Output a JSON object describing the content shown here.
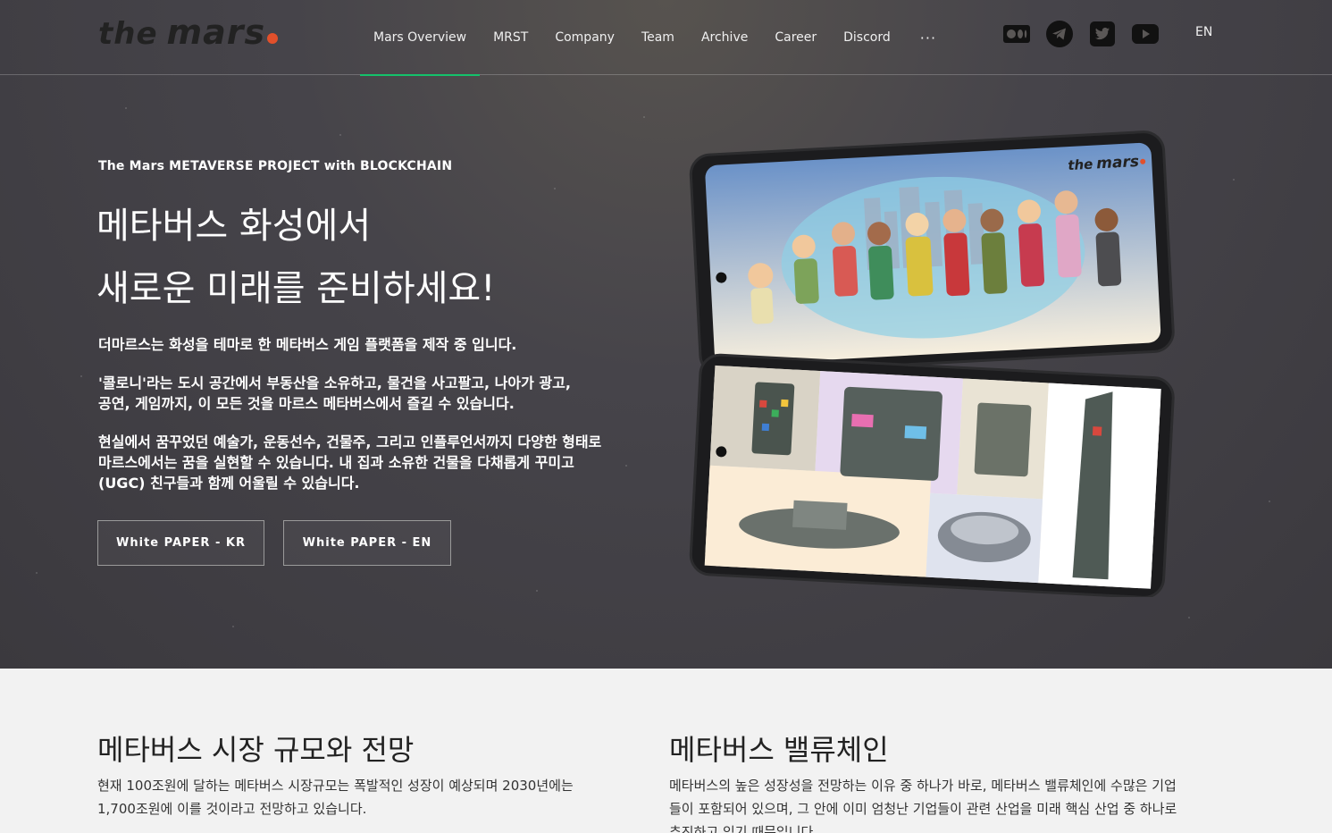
{
  "brand": {
    "name_prefix": "the",
    "name": "mars",
    "accent_color": "#e2502b"
  },
  "nav": {
    "items": [
      {
        "label": "Mars Overview",
        "active": true
      },
      {
        "label": "MRST",
        "active": false
      },
      {
        "label": "Company",
        "active": false
      },
      {
        "label": "Team",
        "active": false
      },
      {
        "label": "Archive",
        "active": false
      },
      {
        "label": "Career",
        "active": false
      },
      {
        "label": "Discord",
        "active": false
      }
    ],
    "more_label": "···",
    "active_color": "#14c26b",
    "socials": [
      "medium-icon",
      "telegram-icon",
      "twitter-icon",
      "youtube-icon"
    ],
    "lang": "EN"
  },
  "hero": {
    "eyebrow": "The Mars METAVERSE PROJECT with BLOCKCHAIN",
    "headline_line1": "메타버스 화성에서",
    "headline_line2": "새로운 미래를 준비하세요!",
    "para1": "더마르스는 화성을 테마로 한 메타버스 게임 플랫폼을 제작 중 입니다.",
    "para2_line1": "'콜로니'라는 도시 공간에서 부동산을 소유하고, 물건을 사고팔고, 나아가 광고,",
    "para2_line2": "공연, 게임까지, 이 모든 것을 마르스 메타버스에서 즐길 수 있습니다.",
    "para3_line1": "현실에서 꿈꾸었던 예술가, 운동선수, 건물주, 그리고 인플루언서까지 다양한 형태로",
    "para3_line2": "마르스에서는 꿈을 실현할 수 있습니다. 내 집과 소유한 건물을 다채롭게 꾸미고",
    "para3_line3": "(UGC) 친구들과 함께 어울릴 수 있습니다.",
    "btn_kr": "White PAPER - KR",
    "btn_en": "White PAPER - EN",
    "phone_logo_prefix": "the",
    "phone_logo": "mars"
  },
  "lower": {
    "left_title": "메타버스 시장 규모와 전망",
    "left_text_line1": "현재 100조원에 달하는 메타버스 시장규모는 폭발적인 성장이 예상되며 2030년에는",
    "left_text_line2": "1,700조원에 이를 것이라고 전망하고 있습니다.",
    "right_title": "메타버스 밸류체인",
    "right_text_line1": "메타버스의 높은 성장성을 전망하는 이유 중 하나가 바로, 메타버스 밸류체인에 수많은 기업",
    "right_text_line2": "들이 포함되어 있으며, 그 안에 이미 엄청난 기업들이 관련 산업을 미래 핵심 산업 중 하나로",
    "right_text_line3": "추진하고 있기 때문입니다."
  }
}
